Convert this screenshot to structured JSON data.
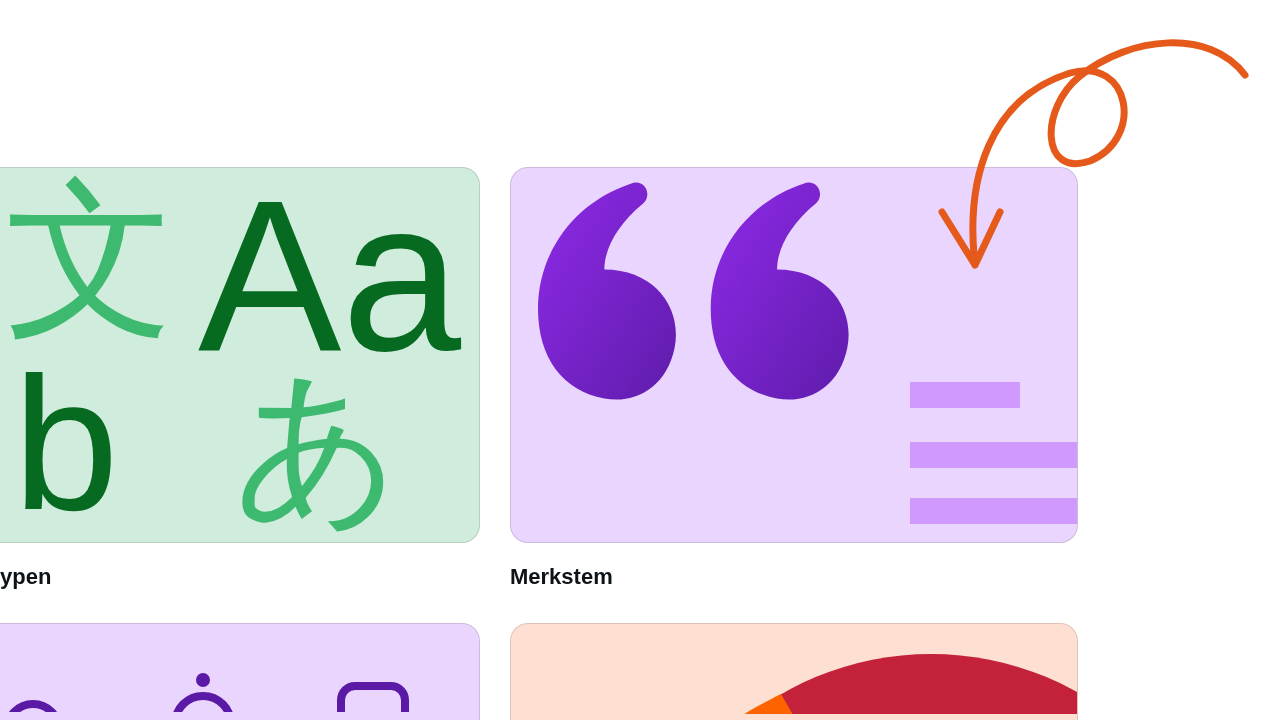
{
  "cards": [
    {
      "kind": "glyphs",
      "label": "ypen",
      "glyphs": [
        "文",
        "Aa",
        "b",
        "あ"
      ]
    },
    {
      "kind": "quote",
      "label": "Merkstem"
    },
    {
      "kind": "shapes"
    },
    {
      "kind": "pie"
    }
  ]
}
